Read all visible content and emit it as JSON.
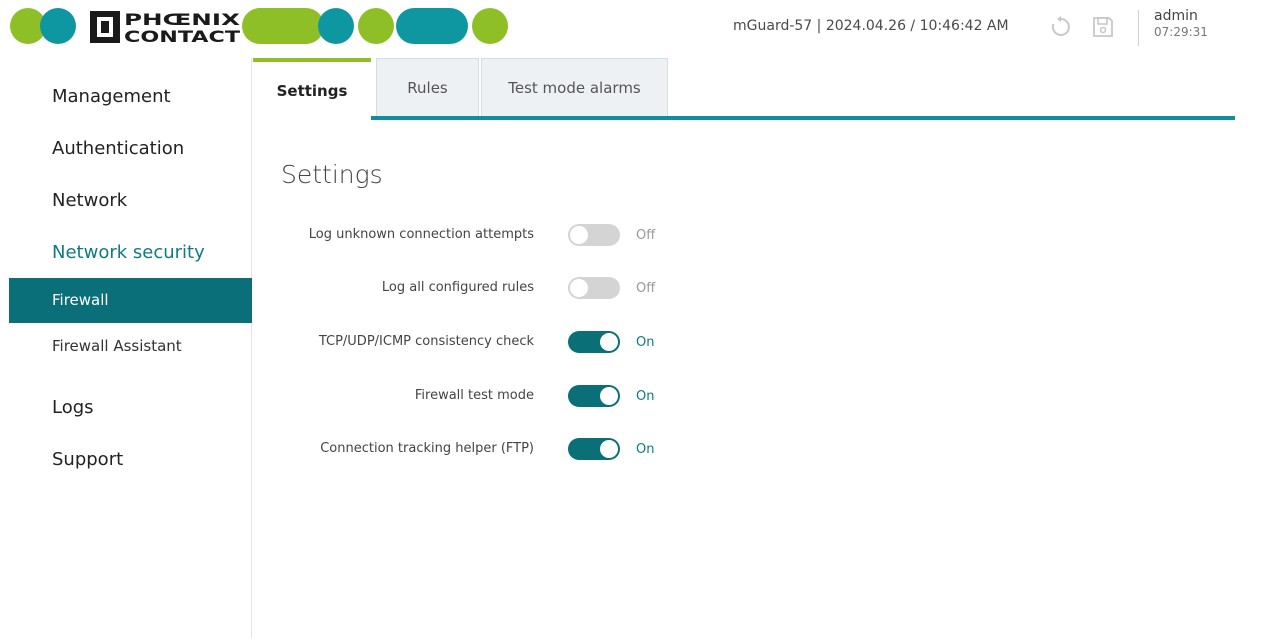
{
  "brand": {
    "logo_text": "PHOENIX CONTACT",
    "colors": {
      "green": "#8fbf27",
      "teal": "#0e97a1",
      "dark_teal": "#0a6f78"
    }
  },
  "header": {
    "device_info": "mGuard-57 | 2024.04.26 / 10:46:42 AM",
    "user": "admin",
    "session_time": "07:29:31",
    "icons": [
      "revert-icon",
      "save-icon"
    ]
  },
  "sidebar": {
    "items": [
      {
        "label": "Management"
      },
      {
        "label": "Authentication"
      },
      {
        "label": "Network"
      },
      {
        "label": "Network security"
      },
      {
        "label": "Firewall"
      },
      {
        "label": "Firewall Assistant"
      },
      {
        "label": "Logs"
      },
      {
        "label": "Support"
      }
    ]
  },
  "tabs": [
    {
      "label": "Settings",
      "active": true
    },
    {
      "label": "Rules",
      "active": false
    },
    {
      "label": "Test mode alarms",
      "active": false
    }
  ],
  "main": {
    "title": "Settings",
    "settings": [
      {
        "label": "Log unknown connection attempts",
        "state": "Off"
      },
      {
        "label": "Log all configured rules",
        "state": "Off"
      },
      {
        "label": "TCP/UDP/ICMP consistency check",
        "state": "On"
      },
      {
        "label": "Firewall test mode",
        "state": "On"
      },
      {
        "label": "Connection tracking helper (FTP)",
        "state": "On"
      }
    ]
  }
}
